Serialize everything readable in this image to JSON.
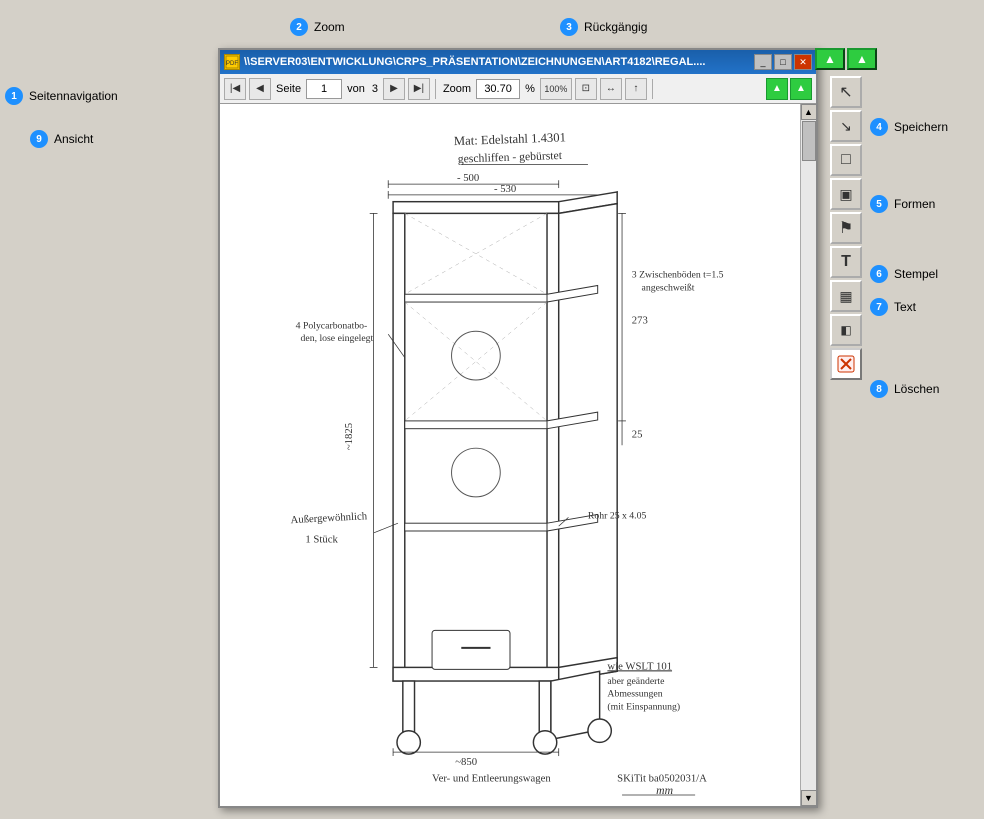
{
  "app": {
    "title_bar": {
      "icon_label": "PDF",
      "file_path": "\\\\SERVER03\\ENTWICKLUNG\\CRPS_PRÄSENTATION\\ZEICHNUNGEN\\ART4182\\REGAL....",
      "btn_minimize": "_",
      "btn_restore": "□",
      "btn_close": "✕"
    },
    "toolbar": {
      "page_label": "Seite",
      "page_current": "1",
      "page_of_label": "von",
      "page_total": "3",
      "zoom_label": "Zoom",
      "zoom_value": "30.70",
      "zoom_percent": "%",
      "zoom_100_label": "100%"
    },
    "outside_labels": {
      "zoom_label": "Zoom",
      "zoom_badge": "2",
      "rueckgaengig_label": "Rückgängig",
      "rueckgaengig_badge": "3",
      "seitennavigation_label": "Seitennavigation",
      "seitennavigation_badge": "1",
      "ansicht_label": "Ansicht",
      "ansicht_badge": "9"
    },
    "right_toolbar": {
      "buttons": [
        {
          "id": "btn-up1",
          "icon": "▲",
          "color": "#2ecc40"
        },
        {
          "id": "btn-up2",
          "icon": "▲",
          "color": "#2ecc40"
        },
        {
          "id": "btn-cursor",
          "icon": "↖",
          "color": ""
        },
        {
          "id": "btn-select",
          "icon": "↘",
          "color": ""
        },
        {
          "id": "btn-rect1",
          "icon": "□",
          "color": ""
        },
        {
          "id": "btn-rect2",
          "icon": "▣",
          "color": ""
        },
        {
          "id": "btn-stamp",
          "icon": "⚑",
          "color": ""
        },
        {
          "id": "btn-text",
          "icon": "T",
          "color": ""
        },
        {
          "id": "btn-table",
          "icon": "▦",
          "color": ""
        },
        {
          "id": "btn-ruler",
          "icon": "◧",
          "color": ""
        },
        {
          "id": "btn-delete",
          "icon": "✕",
          "color": "#cc0000"
        }
      ]
    },
    "right_labels": [
      {
        "id": "label-speichern",
        "badge": "4",
        "text": "Speichern"
      },
      {
        "id": "label-formen",
        "badge": "5",
        "text": "Formen"
      },
      {
        "id": "label-stempel",
        "badge": "6",
        "text": "Stempel"
      },
      {
        "id": "label-text",
        "badge": "7",
        "text": "Text"
      },
      {
        "id": "label-loeschen",
        "badge": "8",
        "text": "Löschen"
      }
    ]
  }
}
